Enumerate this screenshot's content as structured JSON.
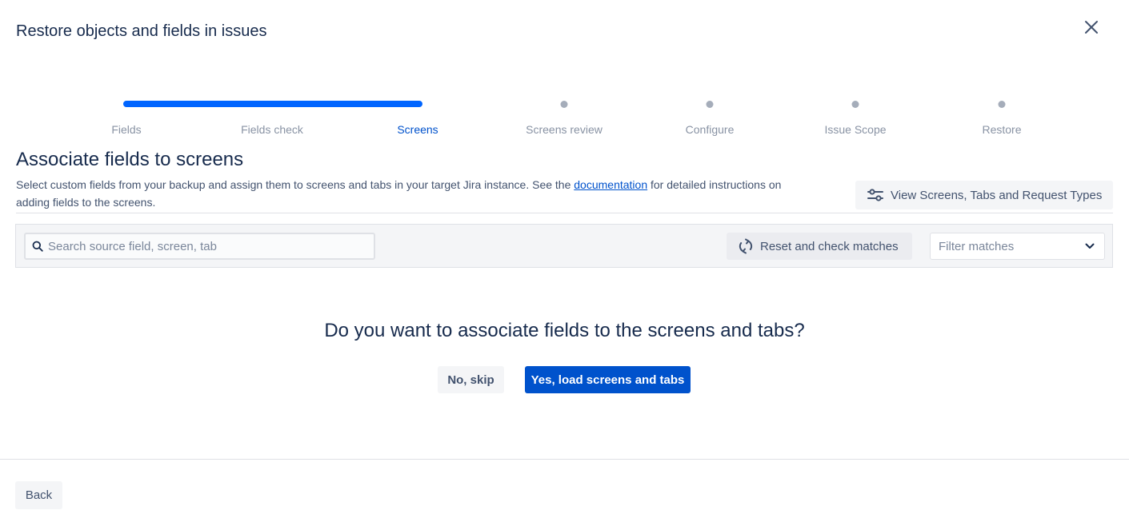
{
  "modal": {
    "title": "Restore objects and fields in issues",
    "close_icon": "close-icon"
  },
  "stepper": {
    "steps": [
      {
        "label": "Fields",
        "state": "completed"
      },
      {
        "label": "Fields check",
        "state": "completed"
      },
      {
        "label": "Screens",
        "state": "active"
      },
      {
        "label": "Screens review",
        "state": "pending"
      },
      {
        "label": "Configure",
        "state": "pending"
      },
      {
        "label": "Issue Scope",
        "state": "pending"
      },
      {
        "label": "Restore",
        "state": "pending"
      }
    ],
    "active_color": "#0052CC",
    "progress_color": "#0065FF",
    "pending_color": "#A5ADBA"
  },
  "section": {
    "title": "Associate fields to screens",
    "desc_before": "Select custom fields from your backup and assign them to screens and tabs in your target Jira instance. See the ",
    "desc_link": "documentation",
    "desc_after": " for detailed instructions on adding fields to the screens."
  },
  "view_button": {
    "label": "View Screens, Tabs and Request Types",
    "icon": "sliders-icon"
  },
  "toolbar": {
    "search_placeholder": "Search source field, screen, tab",
    "search_value": "",
    "reset_label": "Reset and check matches",
    "reset_icon": "refresh-icon",
    "filter_placeholder": "Filter matches"
  },
  "prompt": {
    "question": "Do you want to associate fields to the screens and tabs?",
    "skip_label": "No, skip",
    "yes_label": "Yes, load screens and tabs"
  },
  "footer": {
    "back_label": "Back"
  },
  "colors": {
    "primary": "#0052CC",
    "text": "#172B4D",
    "subtle_text": "#42526E"
  }
}
